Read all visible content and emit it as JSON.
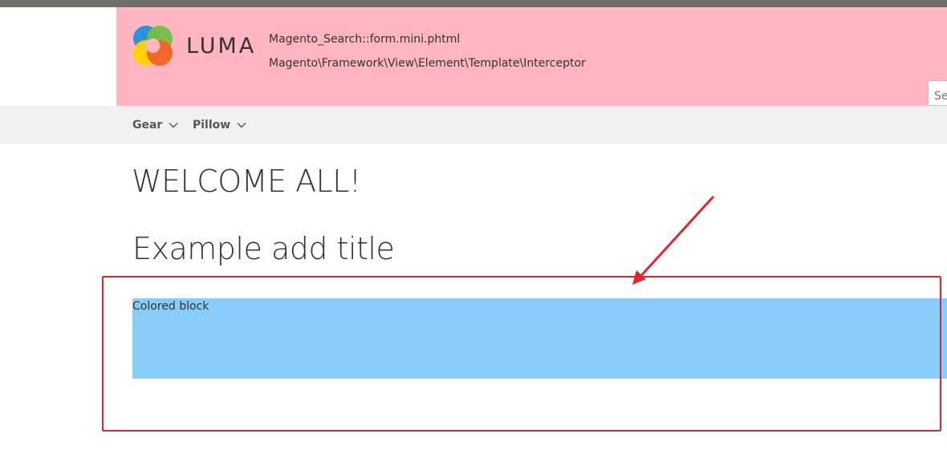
{
  "header": {
    "logo_text": "LUMA",
    "template_hint": "Magento_Search::form.mini.phtml",
    "class_hint": "Magento\\Framework\\View\\Element\\Template\\Interceptor",
    "search_placeholder": "Search entire store here..."
  },
  "nav": {
    "items": [
      {
        "label": "Gear"
      },
      {
        "label": "Pillow"
      }
    ]
  },
  "main": {
    "welcome": "WELCOME ALL!",
    "title": "Example add title",
    "block_text": "Colored block"
  },
  "colors": {
    "topbar": "#6e6e6a",
    "header_hint_bg": "#ffb6c1",
    "nav_bg": "#f0f0f0",
    "block_bg": "#87cdf9",
    "annotation": "#e0262a"
  }
}
